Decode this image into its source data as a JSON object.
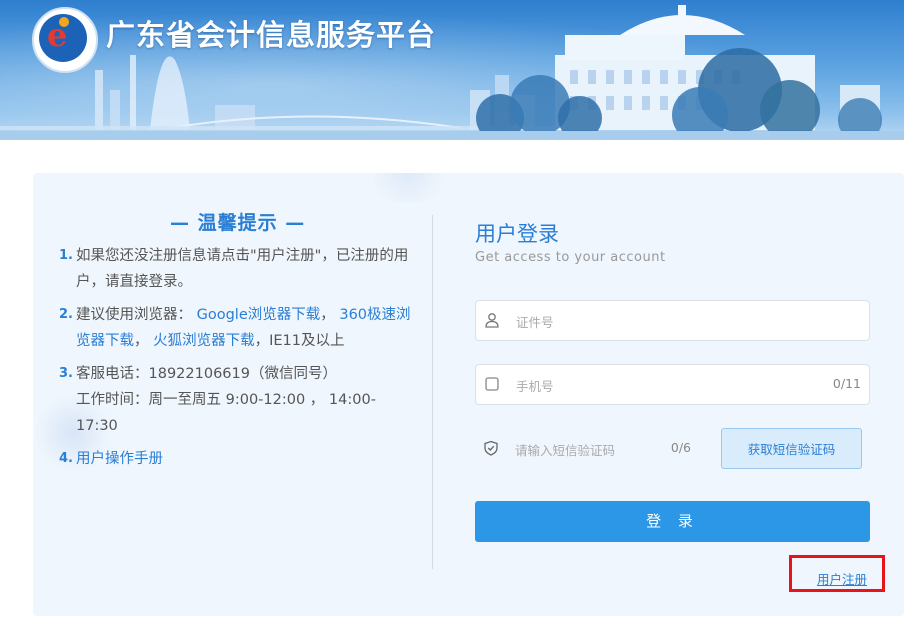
{
  "header": {
    "site_title": "广东省会计信息服务平台"
  },
  "tips": {
    "title": "— 温馨提示 —",
    "items": [
      {
        "num": "1.",
        "text": "如果您还没注册信息请点击\"用户注册\"，已注册的用户，请直接登录。"
      },
      {
        "num": "2.",
        "prefix": "建议使用浏览器：",
        "link1": "Google浏览器下载",
        "sep1": "，",
        "link2": "360极速浏览器下载",
        "sep2": "，",
        "link3": "火狐浏览器下载",
        "suffix": "，IE11及以上"
      },
      {
        "num": "3.",
        "line1": "客服电话：18922106619（微信同号）",
        "line2": "工作时间：周一至周五 9:00-12:00 ， 14:00-17:30"
      },
      {
        "num": "4.",
        "link": "用户操作手册"
      }
    ]
  },
  "login": {
    "title": "用户登录",
    "subtitle": "Get access to your account",
    "id_placeholder": "证件号",
    "phone_placeholder": "手机号",
    "phone_count": "0/11",
    "sms_placeholder": "请输入短信验证码",
    "sms_count": "0/6",
    "sms_button": "获取短信验证码",
    "login_button": "登 录",
    "register_link": "用户注册"
  },
  "colors": {
    "accent": "#2a7fd4",
    "login_button": "#2b97e6",
    "highlight_box": "#e8141a",
    "card_bg": "#f0f6fd"
  },
  "icons": {
    "logo": "accounting-platform-logo",
    "id_field": "user-icon",
    "phone_field": "phone-icon",
    "sms_field": "shield-icon"
  }
}
